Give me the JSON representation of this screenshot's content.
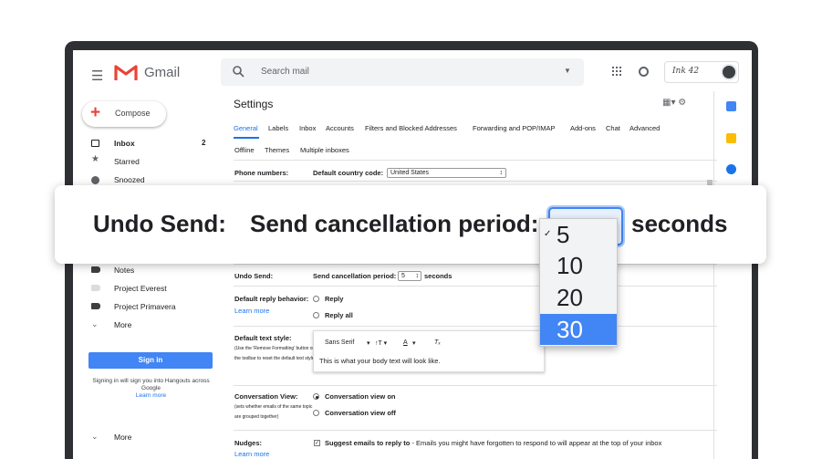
{
  "app": {
    "name": "Gmail"
  },
  "search": {
    "placeholder": "Search mail"
  },
  "account": {
    "label": "Ink 42"
  },
  "sidebar": {
    "compose_label": "Compose",
    "items": [
      {
        "label": "Inbox",
        "count": "2"
      },
      {
        "label": "Starred"
      },
      {
        "label": "Snoozed"
      },
      {
        "label": "Notes"
      },
      {
        "label": "Project Everest"
      },
      {
        "label": "Project Primavera"
      },
      {
        "label": "More"
      }
    ],
    "signin_label": "Sign in",
    "hangouts_text": "Signing in will sign you into Hangouts across Google",
    "learn_more": "Learn more",
    "bottom_more": "More"
  },
  "settings": {
    "title": "Settings",
    "tabs_row1": [
      "General",
      "Labels",
      "Inbox",
      "Accounts",
      "Filters and Blocked Addresses",
      "Forwarding and POP/IMAP",
      "Add-ons",
      "Chat",
      "Advanced"
    ],
    "tabs_row2": [
      "Offline",
      "Themes",
      "Multiple inboxes"
    ],
    "phone": {
      "label": "Phone numbers:",
      "field_label": "Default country code:",
      "value": "United States"
    },
    "undo_send": {
      "label": "Undo Send:",
      "field_label": "Send cancellation period:",
      "value": "5",
      "unit": "seconds"
    },
    "reply": {
      "label": "Default reply behavior:",
      "learn_more": "Learn more",
      "options": [
        "Reply",
        "Reply all"
      ]
    },
    "text_style": {
      "label": "Default text style:",
      "sub": "(Use the 'Remove Formatting' button on the toolbar to reset the default text style)",
      "font": "Sans Serif",
      "sample": "This is what your body text will look like."
    },
    "conversation": {
      "label": "Conversation View:",
      "sub": "(sets whether emails of the same topic are grouped together)",
      "options": [
        "Conversation view on",
        "Conversation view off"
      ]
    },
    "nudges": {
      "label": "Nudges:",
      "learn_more": "Learn more",
      "option_bold": "Suggest emails to reply to",
      "option_text": " - Emails you might have forgotten to respond to will appear at the top of your inbox"
    }
  },
  "zoom": {
    "label": "Undo Send:",
    "field": "Send cancellation period:",
    "unit": "seconds",
    "options": [
      "5",
      "10",
      "20",
      "30"
    ],
    "checked": "5",
    "highlighted": "30"
  },
  "colors": {
    "accent": "#4285f4",
    "gmail_red": "#ea4335",
    "link": "#1a73e8"
  }
}
